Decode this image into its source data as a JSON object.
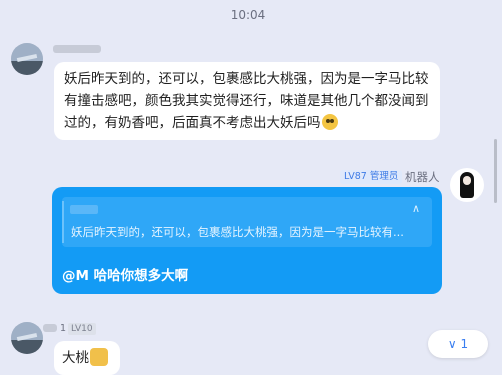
{
  "timestamp": "10:04",
  "message1": {
    "text": "妖后昨天到的，还可以，包裹感比大桃强，因为是一字马比较有撞击感吧，颜色我其实觉得还行，味道是其他几个都没闻到过的，有奶香吧，后面真不考虑出大妖后吗",
    "emoji": "smiling-face-emoji"
  },
  "robot": {
    "badge": "LV87 管理员",
    "name": "机器人"
  },
  "reply": {
    "quote_collapse": "∧",
    "quote_text": "妖后昨天到的，还可以，包裹感比大桃强，因为是一字马比较有...",
    "text": "@M 哈哈你想多大啊"
  },
  "message2": {
    "user_number": "1",
    "level": "LV10",
    "text": "大桃",
    "emoji": "sticker-emoji"
  },
  "jump_button": {
    "icon": "chevron-down-icon",
    "label": "∨  1"
  }
}
